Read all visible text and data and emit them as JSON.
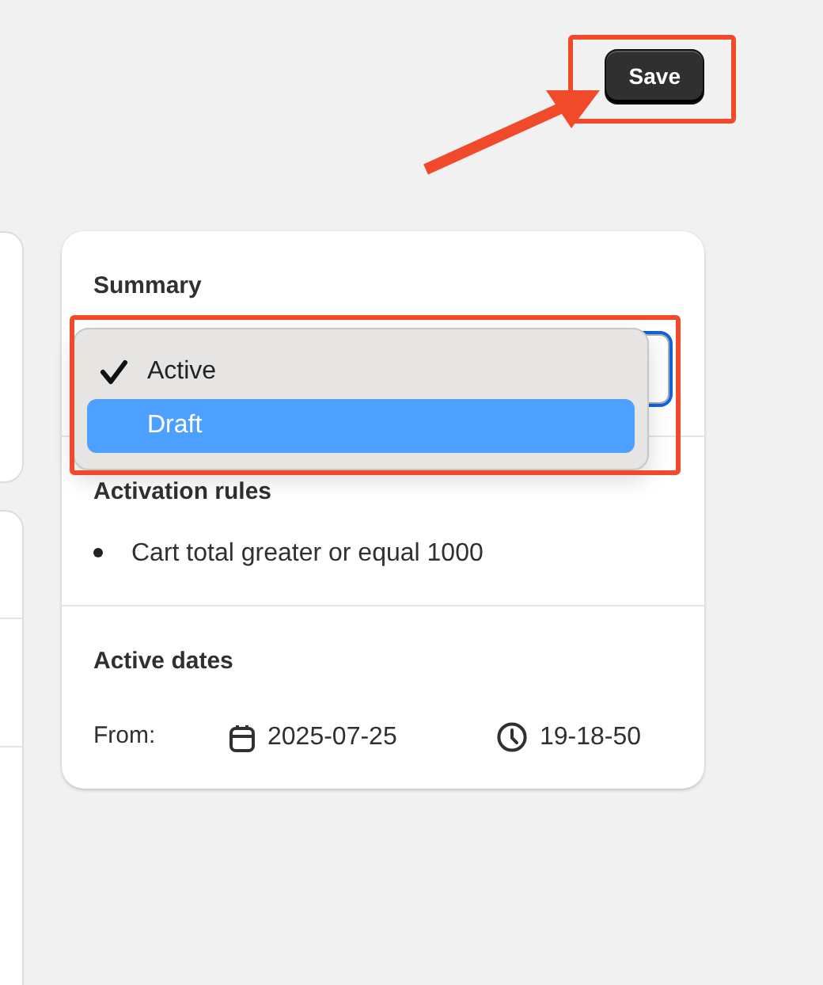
{
  "header": {
    "save_button": "Save"
  },
  "summary_card": {
    "title": "Summary",
    "status_select": {
      "focused": true,
      "options": [
        {
          "label": "Active",
          "selected": true,
          "highlighted": false
        },
        {
          "label": "Draft",
          "selected": false,
          "highlighted": true
        }
      ]
    },
    "activation_rules": {
      "title": "Activation rules",
      "rules": [
        "Cart total greater or equal 1000"
      ]
    },
    "active_dates": {
      "title": "Active dates",
      "from_label": "From:",
      "date": "2025-07-25",
      "time": "19-18-50"
    }
  },
  "annotations": [
    {
      "kind": "box"
    },
    {
      "kind": "arrow"
    },
    {
      "kind": "box"
    }
  ]
}
